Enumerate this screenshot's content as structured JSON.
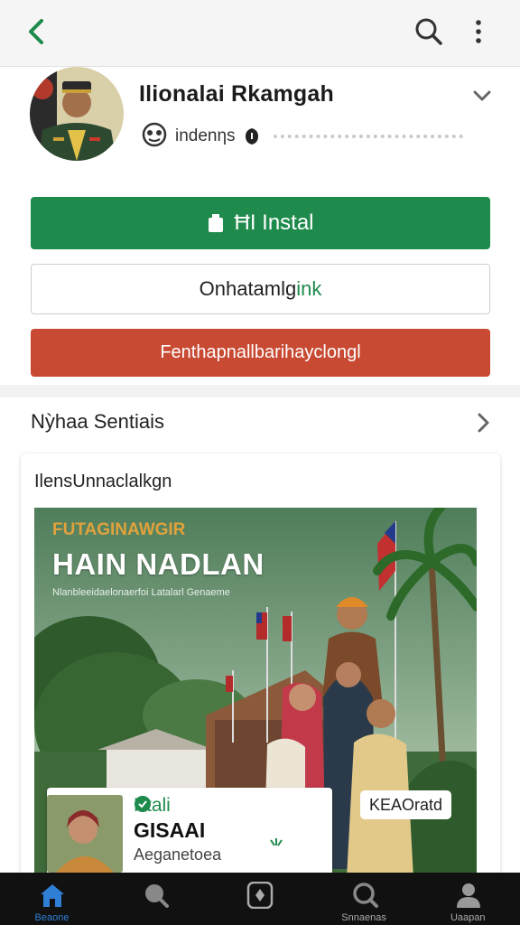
{
  "topbar": {
    "back_icon": "chevron-left-icon",
    "search_icon": "search-icon",
    "more_icon": "more-vertical-icon"
  },
  "profile": {
    "title": "Ilionalai Rkamgah",
    "handle": "indenηs",
    "expand_icon": "chevron-down-icon"
  },
  "actions": {
    "install_label": "ĦI Instal",
    "outline_label_a": "Onhatamlg",
    "outline_label_b": "ink",
    "red_label": "Fenthapnallbarihayclongl"
  },
  "section": {
    "heading": "Nỳhaa Sentiais",
    "card_title": "IlensUnnaclalkgn",
    "banner": {
      "kicker": "FUTAGINAWGIR",
      "headline": "HAIN NADLAN",
      "sub": "Nlanbleeidaelonaerfoi Latalarl Genaeme"
    },
    "overlay": {
      "name": "Ktali",
      "big": "GISAAI",
      "small": "Aeganetoea"
    },
    "tag": "KEAOratd"
  },
  "nav": [
    {
      "label": "Beaone",
      "icon": "home-icon",
      "active": true
    },
    {
      "label": "",
      "icon": "search-icon",
      "active": false
    },
    {
      "label": "",
      "icon": "shield-icon",
      "active": false
    },
    {
      "label": "Snnaenas",
      "icon": "search-icon",
      "active": false
    },
    {
      "label": "Uaapan",
      "icon": "user-icon",
      "active": false
    }
  ],
  "colors": {
    "brand_green": "#1e8a4c",
    "danger_red": "#c84a33",
    "nav_active": "#2f7fd6"
  }
}
